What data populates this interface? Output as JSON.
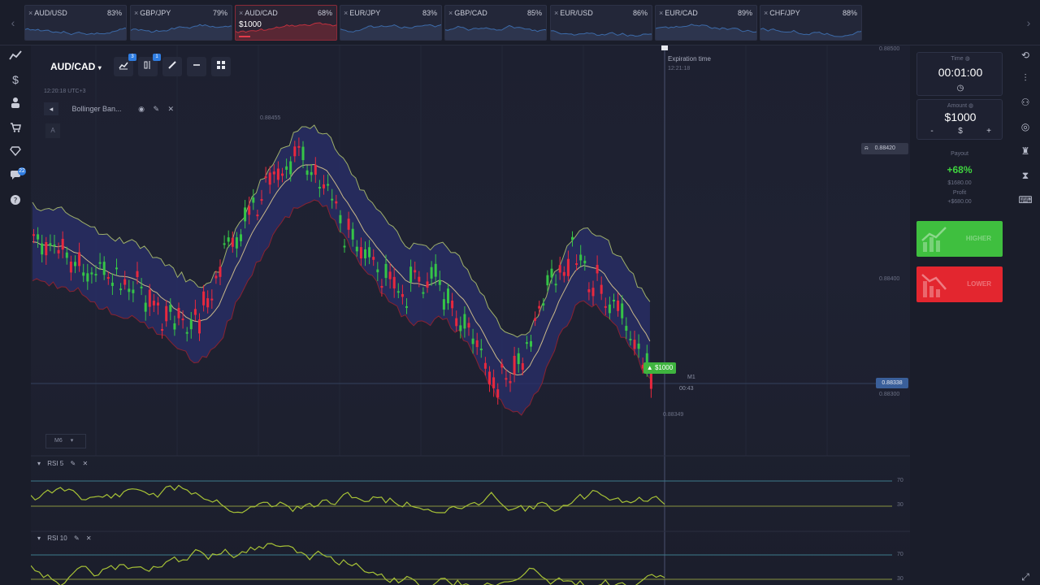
{
  "assets": [
    {
      "name": "AUD/USD",
      "payout": "83%",
      "active": false
    },
    {
      "name": "GBP/JPY",
      "payout": "79%",
      "active": false
    },
    {
      "name": "AUD/CAD",
      "payout": "68%",
      "active": true,
      "amount": "$1000"
    },
    {
      "name": "EUR/JPY",
      "payout": "83%",
      "active": false
    },
    {
      "name": "GBP/CAD",
      "payout": "85%",
      "active": false
    },
    {
      "name": "EUR/USD",
      "payout": "86%",
      "active": false
    },
    {
      "name": "EUR/CAD",
      "payout": "89%",
      "active": false
    },
    {
      "name": "CHF/JPY",
      "payout": "88%",
      "active": false
    }
  ],
  "toolbar": {
    "pair": "AUD/CAD",
    "timezone": "12:20:18   UTC+3",
    "indicator_name": "Bollinger Ban...",
    "timeframe": "M6"
  },
  "chart": {
    "expiration_label": "Expiration time",
    "expiration_time": "12:21:18",
    "price_levels": [
      "0.88500",
      "0.88400",
      "0.88300"
    ],
    "alert_price": "0.88420",
    "current_price": "0.88338",
    "high_label": "0.88455",
    "low_label": "0.88349",
    "trade_amount": "$1000",
    "trade_tf": "M1",
    "trade_timer": "00:43",
    "rsi_panels": [
      {
        "label": "RSI 5",
        "levels": [
          "70",
          "30"
        ]
      },
      {
        "label": "RSI 10",
        "levels": [
          "70",
          "30"
        ]
      }
    ]
  },
  "panel": {
    "time_label": "Time",
    "time_value": "00:01:00",
    "amount_label": "Amount",
    "amount_value": "$1000",
    "minus": "-",
    "currency": "$",
    "plus": "+",
    "payout_label": "Payout",
    "payout_pct": "+68%",
    "payout_amount": "$1680.00",
    "profit_label": "Profit",
    "profit_amount": "+$680.00",
    "higher_label": "HIGHER",
    "lower_label": "LOWER"
  },
  "colors": {
    "up": "#35c447",
    "down": "#e8283e",
    "band_fill": "#2a2f6b",
    "higher_btn": "#3fbf3f",
    "lower_btn": "#e3262f"
  }
}
